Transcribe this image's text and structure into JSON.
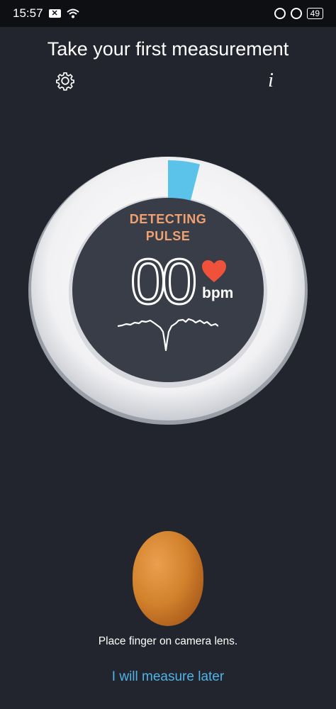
{
  "status_bar": {
    "time": "15:57",
    "notification_badge": "✕",
    "battery": "49",
    "icons": [
      "close-notification-icon",
      "wifi-icon",
      "data-saver-icon",
      "lock-rotation-icon",
      "battery-icon"
    ]
  },
  "header": {
    "title": "Take your first measurement",
    "settings_icon": "gear-icon",
    "info_label": "i"
  },
  "gauge": {
    "status_line1": "DETECTING",
    "status_line2": "PULSE",
    "bpm_value": "00",
    "bpm_unit": "bpm",
    "progress": 0.04,
    "colors": {
      "progress": "#5bc2ea",
      "status": "#f0a172",
      "heart": "#f0513b",
      "dial": "#383d48"
    }
  },
  "instruction": "Place finger on camera lens.",
  "later_link": "I will measure later",
  "accent_color": "#4fb3e6"
}
